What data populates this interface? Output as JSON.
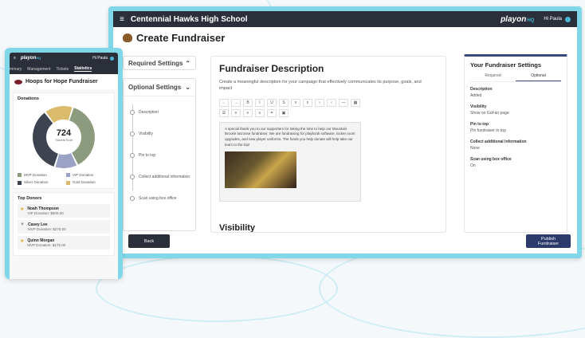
{
  "main": {
    "school_name": "Centennial Hawks High School",
    "logo": "playon",
    "logo_suffix": "HQ",
    "user": "Hi Paula",
    "page_title": "Create Fundraiser",
    "required_settings": "Required Settings",
    "optional_settings": "Optional Settings",
    "steps": [
      "Description",
      "Visibility",
      "Pin to top",
      "Collect additional information",
      "Scan using box office"
    ],
    "section_title": "Fundraiser Description",
    "section_desc": "Create a meaningful description for your campaign that effectively communicates its purpose, goals, and impact",
    "toolbar_icons": [
      "undo-icon",
      "redo-icon",
      "bold-icon",
      "italic-icon",
      "underline-icon",
      "strikethrough-icon",
      "subscript-icon",
      "superscript-icon",
      "indent-icon",
      "outdent-icon",
      "hr-icon",
      "table-icon",
      "list-icon",
      "align-left-icon",
      "align-center-icon",
      "align-right-icon",
      "link-icon",
      "image-icon"
    ],
    "toolbar_glyphs": [
      "←",
      "→",
      "B",
      "I",
      "U",
      "S",
      "x",
      "x",
      "›",
      "‹",
      "—",
      "▦",
      "☰",
      "≡",
      "≡",
      "≡",
      "⚭",
      "▣"
    ],
    "editor_text": "A special thank you to our supporters for taking the time to help our Mountain Brooke lacrosse fundraiser. We are fundraising for playbook software, locker room upgrades, and new player uniforms. The funds you help donate will help take our team to the top!",
    "next_section": "Visibility",
    "back_button": "Back",
    "publish_button": "Publish Fundraiser",
    "right_panel": {
      "title": "Your Fundraiser Settings",
      "tab_required": "Required",
      "tab_optional": "Optional",
      "settings": [
        {
          "label": "Description",
          "value": "Added"
        },
        {
          "label": "Visibility",
          "value": "Show on GoFan page"
        },
        {
          "label": "Pin to top",
          "value": "Pin fundraiser to top"
        },
        {
          "label": "Collect additional information",
          "value": "None"
        },
        {
          "label": "Scan using box office",
          "value": "On"
        }
      ]
    }
  },
  "phone": {
    "logo": "playon",
    "logo_suffix": "HQ",
    "user": "Hi Paula",
    "tabs": [
      "mmary",
      "Management",
      "Tickets",
      "Statistics"
    ],
    "active_tab": "Statistics",
    "fundraiser_title": "Hoops for Hope Fundraiser",
    "donations_label": "Donations",
    "center_value": "724",
    "center_label": "Tickets Sold",
    "top_donors_label": "Top Donors",
    "donors": [
      {
        "name": "Noah Thompson",
        "detail": "VIP Donation: $500.00",
        "mark": "★",
        "mark_color": "#e0a82e"
      },
      {
        "name": "Casey Lee",
        "detail": "MVP Donation: $275.00",
        "mark": "▼",
        "mark_color": "#999999"
      },
      {
        "name": "Quinn Morgan",
        "detail": "MVP Donation: $175.00",
        "mark": "★",
        "mark_color": "#e0a82e"
      }
    ]
  },
  "chart_data": {
    "type": "pie",
    "title": "Donations",
    "categories": [
      "MVP Donation",
      "VIP Donation",
      "Silver Donation",
      "Gold Donation"
    ],
    "values": [
      38,
      12,
      35,
      15
    ],
    "colors": [
      "#8c9b7e",
      "#9aa3c4",
      "#3e4350",
      "#d9bb6b"
    ],
    "legend_position": "bottom"
  }
}
